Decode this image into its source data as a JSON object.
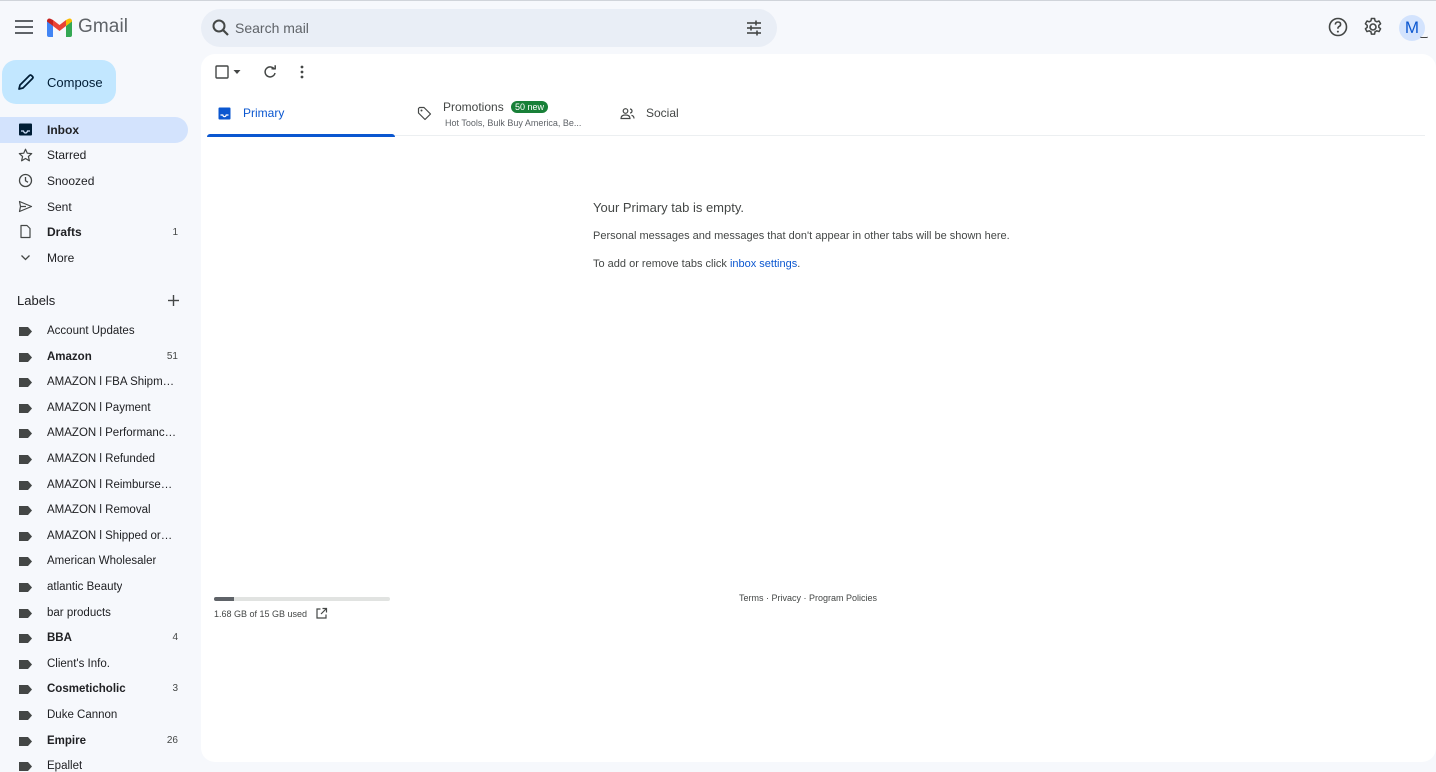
{
  "header": {
    "app_name": "Gmail",
    "search_placeholder": "Search mail",
    "avatar_letter": "M"
  },
  "sidebar": {
    "compose_label": "Compose",
    "nav": [
      {
        "label": "Inbox",
        "count": "",
        "icon": "inbox-icon",
        "active": true,
        "bold": true
      },
      {
        "label": "Starred",
        "count": "",
        "icon": "star-icon",
        "active": false,
        "bold": false
      },
      {
        "label": "Snoozed",
        "count": "",
        "icon": "clock-icon",
        "active": false,
        "bold": false
      },
      {
        "label": "Sent",
        "count": "",
        "icon": "send-icon",
        "active": false,
        "bold": false
      },
      {
        "label": "Drafts",
        "count": "1",
        "icon": "draft-icon",
        "active": false,
        "bold": true
      },
      {
        "label": "More",
        "count": "",
        "icon": "chevron-down-icon",
        "active": false,
        "bold": false
      }
    ],
    "labels_heading": "Labels",
    "labels": [
      {
        "label": "Account Updates",
        "count": "",
        "bold": false
      },
      {
        "label": "Amazon",
        "count": "51",
        "bold": true
      },
      {
        "label": "AMAZON l FBA Shipmen...",
        "count": "",
        "bold": false
      },
      {
        "label": "AMAZON l Payment",
        "count": "",
        "bold": false
      },
      {
        "label": "AMAZON l Performance...",
        "count": "",
        "bold": false
      },
      {
        "label": "AMAZON l Refunded",
        "count": "",
        "bold": false
      },
      {
        "label": "AMAZON l Reimbursem...",
        "count": "",
        "bold": false
      },
      {
        "label": "AMAZON l Removal",
        "count": "",
        "bold": false
      },
      {
        "label": "AMAZON l Shipped order",
        "count": "",
        "bold": false
      },
      {
        "label": "American Wholesaler",
        "count": "",
        "bold": false
      },
      {
        "label": "atlantic Beauty",
        "count": "",
        "bold": false
      },
      {
        "label": "bar products",
        "count": "",
        "bold": false
      },
      {
        "label": "BBA",
        "count": "4",
        "bold": true
      },
      {
        "label": "Client's Info.",
        "count": "",
        "bold": false
      },
      {
        "label": "Cosmeticholic",
        "count": "3",
        "bold": true
      },
      {
        "label": "Duke Cannon",
        "count": "",
        "bold": false
      },
      {
        "label": "Empire",
        "count": "26",
        "bold": true
      },
      {
        "label": "Epallet",
        "count": "",
        "bold": false
      }
    ]
  },
  "tabs": [
    {
      "label": "Primary",
      "icon": "inbox-icon",
      "active": true,
      "badge": "",
      "snippet": ""
    },
    {
      "label": "Promotions",
      "icon": "tag-icon",
      "active": false,
      "badge": "50 new",
      "snippet": "Hot Tools, Bulk Buy America, Be..."
    },
    {
      "label": "Social",
      "icon": "people-icon",
      "active": false,
      "badge": "",
      "snippet": ""
    }
  ],
  "empty_state": {
    "title": "Your Primary tab is empty.",
    "line1": "Personal messages and messages that don't appear in other tabs will be shown here.",
    "line2_prefix": "To add or remove tabs click ",
    "line2_link": "inbox settings",
    "line2_suffix": "."
  },
  "storage": {
    "text": "1.68 GB of 15 GB used",
    "fraction_used": 0.112
  },
  "footer": {
    "terms": "Terms",
    "privacy": "Privacy",
    "policies": "Program Policies",
    "separator": " · "
  },
  "colors": {
    "accent": "#0b57d0",
    "compose_bg": "#c2e7ff",
    "active_nav_bg": "#d3e3fd",
    "badge_green": "#188038",
    "app_bg": "#f6f8fc"
  }
}
